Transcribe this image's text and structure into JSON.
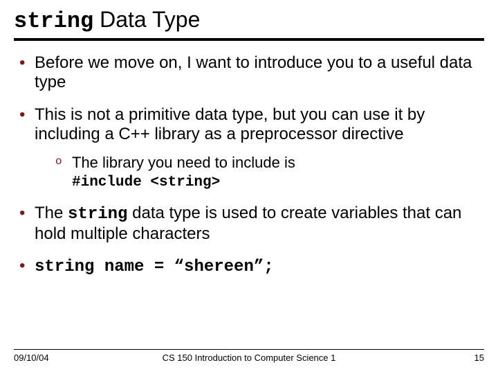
{
  "title": {
    "code": "string",
    "rest": " Data Type"
  },
  "bullets": {
    "b1": "Before we move on, I want to introduce you to a useful data type",
    "b2": "This is not a primitive data type, but you can use it by including a C++ library as a preprocessor directive",
    "sub1": "The library you need to include is",
    "sub1_code": "#include <string>",
    "b3_pre": "The ",
    "b3_code": "string",
    "b3_post": " data type is used to create variables that can hold multiple characters",
    "b4_code": "string name = “shereen”;"
  },
  "footer": {
    "date": "09/10/04",
    "course": "CS 150 Introduction to Computer Science 1",
    "page": "15"
  }
}
